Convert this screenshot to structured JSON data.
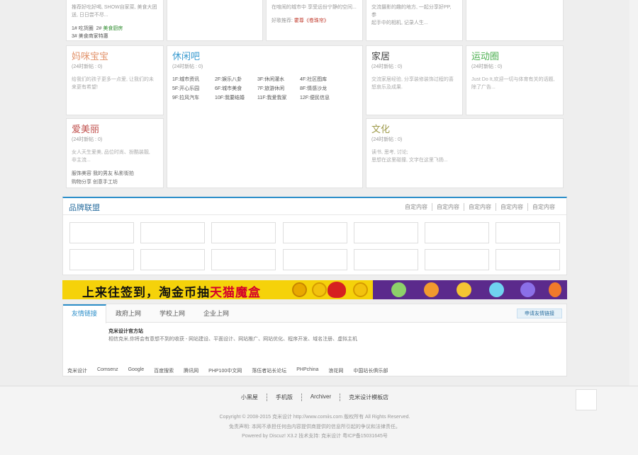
{
  "top_row": {
    "card1_desc": [
      "推荐好吃好喝, SHOW自家菜, 美食大团",
      "送, 日日尝不尽..."
    ],
    "card1_threads": [
      {
        "num": "1#",
        "text": "吃货圈",
        "num2": "2#",
        "text2": "美食厨房"
      },
      {
        "num": "3#",
        "text": "美食商家特惠"
      }
    ],
    "card2_desc": "在喧闹的城市中 享受远份宁静的空间...",
    "card2_recommend_label": "好歌推荐:",
    "card2_recommend_value": "霍尊《卷珠帘》",
    "card3_desc": [
      "交流摄影的趣的地方, 一起分享好PP, 参",
      "起手中的相机, 记录人生..."
    ]
  },
  "forums": {
    "mami": {
      "title": "妈咪宝宝",
      "sub": "(24时新帖 : 0)",
      "desc": [
        "给我们的孩子更多一点爱, 让我们的未",
        "来更有希望!"
      ],
      "color": "#e2926a"
    },
    "xiuxian": {
      "title": "休闲吧",
      "sub": "(24时新帖 : 0)",
      "color": "#3a9bd0",
      "links": [
        "1F:城市资讯",
        "2F:娱乐八卦",
        "3F:休闲灌水",
        "4F:社区图库",
        "5F:开心乐园",
        "6F:城市美食",
        "7F:旅游休闲",
        "8F:情感沙龙",
        "9F:拉风汽车",
        "10F:我要结婚",
        "11F:我爱我家",
        "12F:便民信息"
      ]
    },
    "jiaju": {
      "title": "家居",
      "sub": "(24时新帖 : 0)",
      "desc": [
        "交流家居经验, 分享装修装饰过程的喜",
        "怒哀乐及成果."
      ],
      "color": "#444444"
    },
    "yundong": {
      "title": "运动圈",
      "sub": "(24时新帖 : 0)",
      "desc": [
        "Just Do It,欢迎一切与体育有关的话题,",
        "除了广告..."
      ],
      "color": "#4caf50"
    },
    "aimeili": {
      "title": "爱美丽",
      "sub": "(24时新帖 : 0)",
      "desc": [
        "女人天生爱美, 品位时尚、扮酷装靓,",
        "非主流..."
      ],
      "color": "#c0504d",
      "links": [
        "服饰美容  我的男友  私影街拍",
        "购物分享  创意手工坊"
      ]
    },
    "wenhua": {
      "title": "文化",
      "sub": "(24时新帖 : 0)",
      "desc": [
        "读书, 思考, 讨论;",
        "思想在这里碰撞, 文字在这里飞扬..."
      ],
      "color": "#9e9a4a"
    }
  },
  "brand": {
    "title": "品牌联盟",
    "tabs": [
      "自定内容",
      "自定内容",
      "自定内容",
      "自定内容",
      "自定内容"
    ]
  },
  "banner": {
    "text_black": "上来往签到，淘金币抽",
    "text_red": "天猫魔盒"
  },
  "links": {
    "tabs": [
      "友情链接",
      "政府上网",
      "学校上网",
      "企业上网"
    ],
    "apply": "申请友情链接",
    "site_name": "克米设计官方站",
    "site_desc": "相信克米,你将会有意想不到的收获 - 网站建设、平面设计、网站推广、网站优化、程序开发、域名注册、虚拟主机",
    "friends": [
      "克米设计",
      "Comsenz",
      "Google",
      "百度搜索",
      "腾讯网",
      "PHP100中文网",
      "落伍者站长论坛",
      "PHPchina",
      "浪花网",
      "中国站长俱乐部"
    ]
  },
  "footer": {
    "nav": [
      "小黑屋",
      "手机版",
      "Archiver",
      "克米设计模板店"
    ],
    "copyright": "Copyright © 2008-2015 克米设计 http://www.comiis.com 版权所有 All Rights Reserved.",
    "disclaimer": "免责声明: 本网不承担任何由内容提供商提供的信息所引起的争议和法律责任。",
    "powered": "Powered by Discuz! X3.2  技术支持: 克米设计 粤ICP备15031645号"
  }
}
